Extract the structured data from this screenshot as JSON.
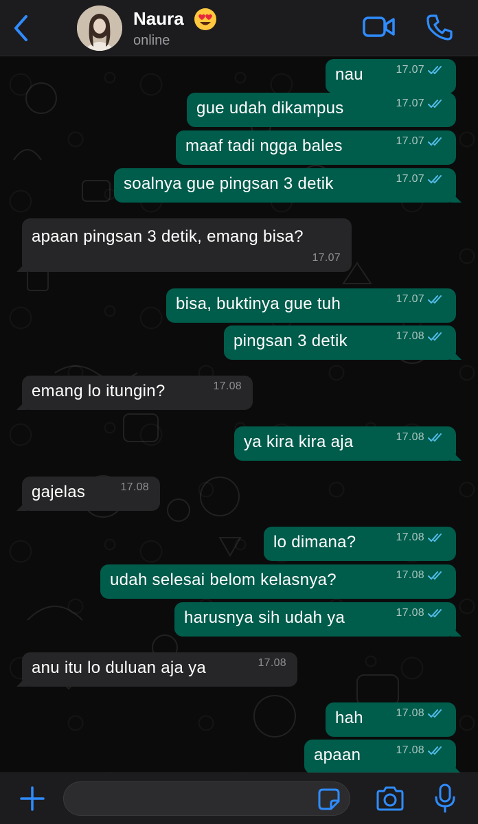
{
  "header": {
    "contact_name": "Naura",
    "status": "online"
  },
  "icons": {
    "back": "chevron-left-icon",
    "video": "video-call-icon",
    "phone": "phone-icon",
    "add": "plus-icon",
    "sticker": "sticker-icon",
    "camera": "camera-icon",
    "mic": "microphone-icon"
  },
  "colors": {
    "accent": "#2f8cff",
    "outgoing_bubble": "#005c4b",
    "incoming_bubble": "#262628",
    "read_tick": "#53bdeb"
  },
  "messages": [
    {
      "dir": "out",
      "text": "nau",
      "time": "17.07",
      "read": true
    },
    {
      "dir": "out",
      "text": "gue udah dikampus",
      "time": "17.07",
      "read": true
    },
    {
      "dir": "out",
      "text": "maaf tadi ngga bales",
      "time": "17.07",
      "read": true
    },
    {
      "dir": "out",
      "text": "soalnya gue pingsan 3 detik",
      "time": "17.07",
      "read": true
    },
    {
      "dir": "in",
      "text": "apaan pingsan 3 detik, emang bisa?",
      "time": "17.07"
    },
    {
      "dir": "out",
      "text": "bisa, buktinya gue tuh",
      "time": "17.07",
      "read": true
    },
    {
      "dir": "out",
      "text": "pingsan 3 detik",
      "time": "17.08",
      "read": true
    },
    {
      "dir": "in",
      "text": "emang lo itungin?",
      "time": "17.08"
    },
    {
      "dir": "out",
      "text": "ya kira kira aja",
      "time": "17.08",
      "read": true
    },
    {
      "dir": "in",
      "text": "gajelas",
      "time": "17.08"
    },
    {
      "dir": "out",
      "text": "lo dimana?",
      "time": "17.08",
      "read": true
    },
    {
      "dir": "out",
      "text": "udah selesai belom kelasnya?",
      "time": "17.08",
      "read": true
    },
    {
      "dir": "out",
      "text": "harusnya sih udah ya",
      "time": "17.08",
      "read": true
    },
    {
      "dir": "in",
      "text": "anu itu lo duluan aja ya",
      "time": "17.08"
    },
    {
      "dir": "out",
      "text": "hah",
      "time": "17.08",
      "read": true
    },
    {
      "dir": "out",
      "text": "apaan",
      "time": "17.08",
      "read": true
    }
  ],
  "composer": {
    "value": "",
    "placeholder": ""
  }
}
